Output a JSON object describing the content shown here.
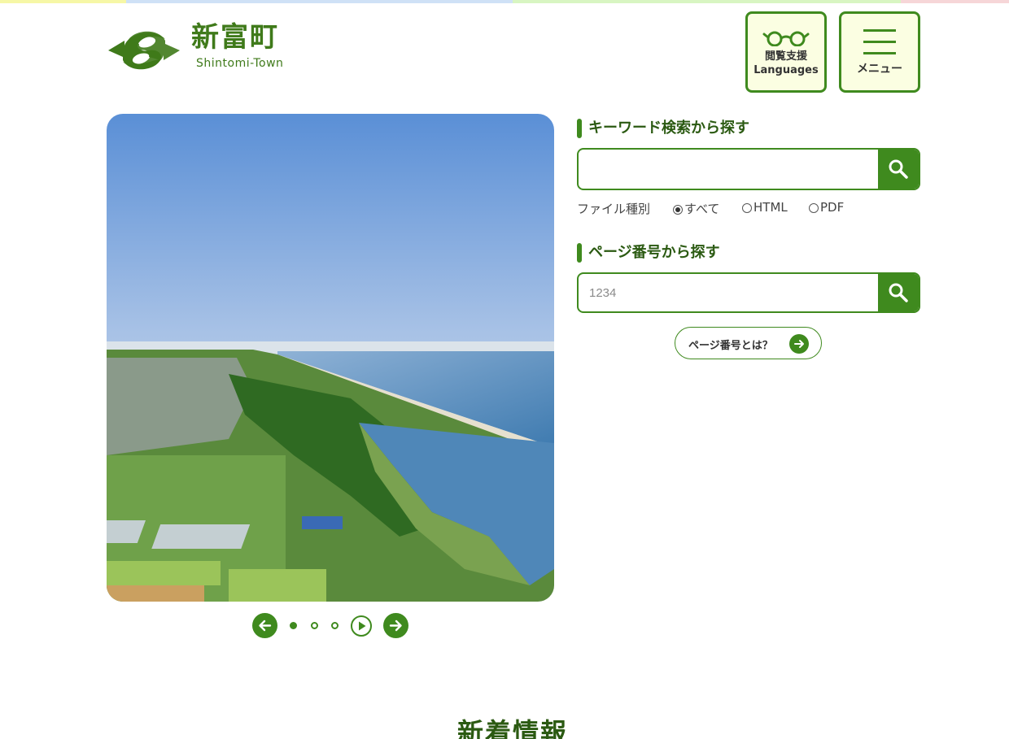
{
  "header": {
    "logo_title": "新富町",
    "logo_subtitle": "Shintomi-Town",
    "accessibility_button": {
      "line1": "閲覧支援",
      "line2": "Languages"
    },
    "menu_button": {
      "label": "メニュー"
    }
  },
  "colors": {
    "brand_green": "#3f8a1e",
    "heading_green": "#2b5a12",
    "button_bg": "#fbfee2",
    "top_strip": [
      "#f6f7a6",
      "#cfe1f6",
      "#d8f5c2",
      "#f6d6d8"
    ]
  },
  "hero": {
    "image": "aerial-coastline-photo",
    "slider": {
      "slide_count": 3,
      "active_index": 0,
      "controls": [
        "prev",
        "dot",
        "dot",
        "dot",
        "play",
        "next"
      ]
    }
  },
  "keyword_search": {
    "title": "キーワード検索から探す",
    "input_value": "",
    "placeholder": "",
    "file_type_label": "ファイル種別",
    "file_types": [
      {
        "label": "すべて",
        "selected": true
      },
      {
        "label": "HTML",
        "selected": false
      },
      {
        "label": "PDF",
        "selected": false
      }
    ]
  },
  "page_search": {
    "title": "ページ番号から探す",
    "placeholder": "1234",
    "help_link": "ページ番号とは？"
  },
  "news": {
    "title": "新着情報"
  }
}
